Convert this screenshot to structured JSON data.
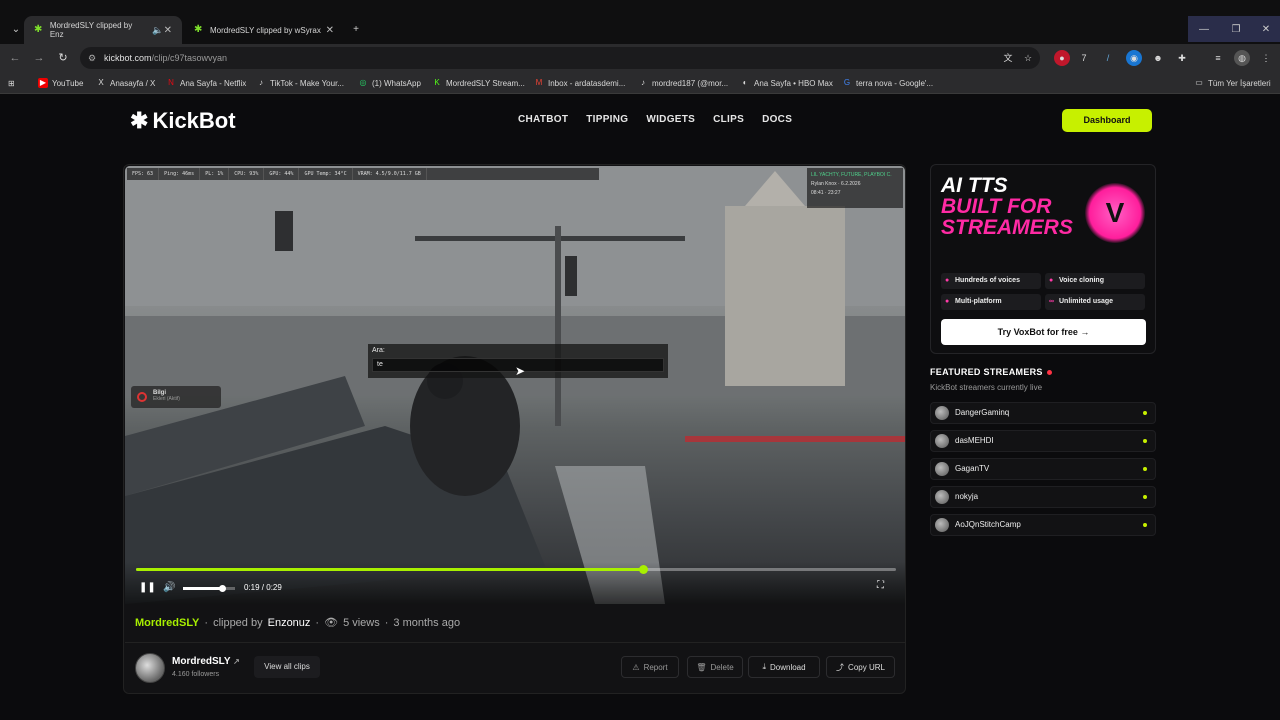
{
  "browser": {
    "tabs": [
      {
        "label": "MordredSLY clipped by Enz"
      },
      {
        "label": "MordredSLY clipped by wSyrax"
      }
    ],
    "url_host": "kickbot.com",
    "url_path": "/clip/c97tasowvyan",
    "bookmarks": [
      "YouTube",
      "Anasayfa / X",
      "Ana Sayfa - Netflix",
      "TikTok - Make Your...",
      "(1) WhatsApp",
      "MordredSLY Stream...",
      "Inbox - ardatasdemi...",
      "mordred187 (@mor...",
      "Ana Sayfa • HBO Max",
      "terra nova - Google'..."
    ],
    "all_bookmarks": "Tüm Yer İşaretleri"
  },
  "site": {
    "logo": "KickBot",
    "nav": [
      "CHATBOT",
      "TIPPING",
      "WIDGETS",
      "CLIPS",
      "DOCS"
    ],
    "dashboard_label": "Dashboard"
  },
  "video": {
    "hud": [
      "FPS: 63",
      "Ping: 46ms",
      "PL: 1%",
      "CPU: 93%",
      "GPU: 44%",
      "GPU Temp: 34°C",
      "VRAM: 4.5/9.0/11.7 GB"
    ],
    "overlay_top": "LIL YACHTY, FUTURE, PLAYBOI C.",
    "overlay_player": "Rylan Knox",
    "overlay_date": "6.2.2026",
    "overlay_time1": "08:41",
    "overlay_time2": "23:27",
    "chat_label": "Ara:",
    "chat_input": "te",
    "notif_title": "Bilgi",
    "notif_text": "Ekleri (Aktif)",
    "time_current": "0:19",
    "time_total": "0:29",
    "progress": 0.667,
    "volume": 0.75
  },
  "clip": {
    "streamer": "MordredSLY",
    "clipped_by_prefix": "clipped by",
    "clipper": "Enzonuz",
    "views": "5 views",
    "age": "3 months ago",
    "channel_name": "MordredSLY",
    "followers": "4.160 followers",
    "view_all": "View all clips",
    "actions": {
      "report": "Report",
      "delete": "Delete",
      "download": "Download",
      "copy_url": "Copy URL"
    }
  },
  "promo": {
    "line1": "AI TTS",
    "line2": "BUILT FOR",
    "line3": "STREAMERS",
    "badge_letter": "V",
    "features": [
      "Hundreds of voices",
      "Voice cloning",
      "Multi-platform",
      "Unlimited usage"
    ],
    "cta": "Try VoxBot for free →"
  },
  "featured": {
    "title": "FEATURED STREAMERS",
    "subtitle": "KickBot streamers currently live",
    "streamers": [
      "DangerGaminq",
      "dasMEHDI",
      "GaganTV",
      "nokyja",
      "AoJQnStitchCamp"
    ]
  },
  "colors": {
    "accent": "#c7f000",
    "pink": "#ff2aa4"
  }
}
